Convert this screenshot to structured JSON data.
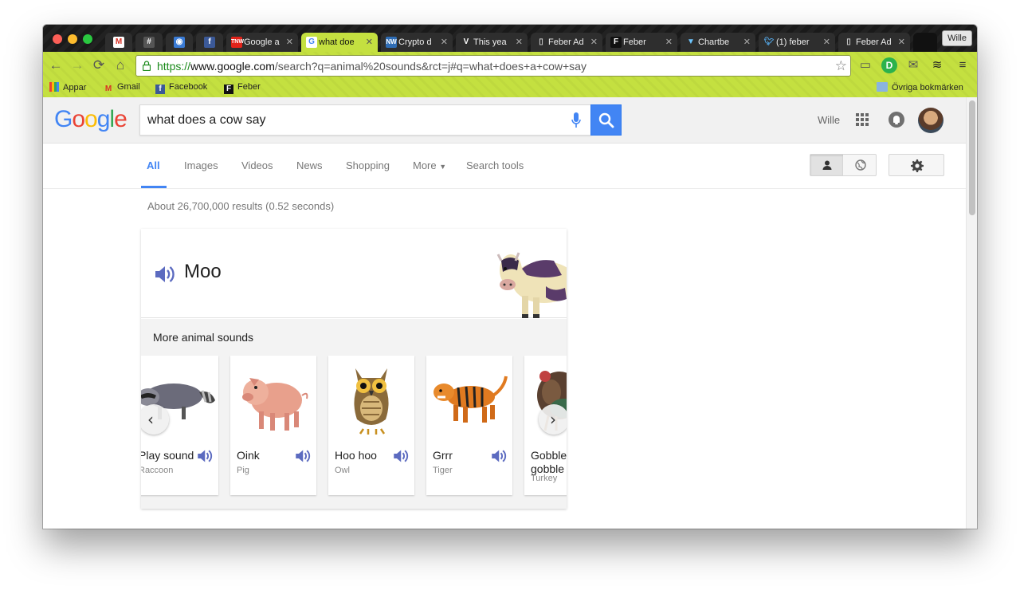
{
  "browser": {
    "profile_name": "Wille",
    "tabs": [
      {
        "label": "",
        "icon": "gmail-icon"
      },
      {
        "label": "",
        "icon": "hashtag-icon"
      },
      {
        "label": "",
        "icon": "rss-icon"
      },
      {
        "label": "",
        "icon": "facebook-icon"
      },
      {
        "label": "Google a",
        "icon": "tnw-icon"
      },
      {
        "label": "what doe",
        "icon": "google-icon"
      },
      {
        "label": "Crypto d",
        "icon": "nw-icon"
      },
      {
        "label": "This yea",
        "icon": "verge-icon"
      },
      {
        "label": "Feber Ad",
        "icon": "page-icon"
      },
      {
        "label": "Feber",
        "icon": "feber-icon"
      },
      {
        "label": "Chartbe",
        "icon": "chartbeat-icon"
      },
      {
        "label": "(1) feber",
        "icon": "twitter-icon"
      },
      {
        "label": "Feber Ad",
        "icon": "page-icon"
      }
    ],
    "url_scheme": "https://",
    "url_host": "www.google.com",
    "url_rest": "/search?q=animal%20sounds&rct=j#q=what+does+a+cow+say",
    "bookmarks": [
      {
        "label": "Appar",
        "icon": "apps-icon"
      },
      {
        "label": "Gmail",
        "icon": "gmail-icon"
      },
      {
        "label": "Facebook",
        "icon": "facebook-icon"
      },
      {
        "label": "Feber",
        "icon": "feber-icon"
      }
    ],
    "other_bookmarks": "Övriga bokmärken"
  },
  "google": {
    "logo": [
      "G",
      "o",
      "o",
      "g",
      "l",
      "e"
    ],
    "logo_colors": [
      "#4285f4",
      "#ea4335",
      "#fbbc05",
      "#4285f4",
      "#34a853",
      "#ea4335"
    ],
    "query": "what does a cow say",
    "user_name": "Wille",
    "nav_tabs": [
      "All",
      "Images",
      "Videos",
      "News",
      "Shopping",
      "More",
      "Search tools"
    ],
    "result_stats": "About 26,700,000 results (0.52 seconds)"
  },
  "answer": {
    "sound": "Moo",
    "more_label": "More animal sounds",
    "animals": [
      {
        "sound": "Play sound",
        "name": "Raccoon"
      },
      {
        "sound": "Oink",
        "name": "Pig"
      },
      {
        "sound": "Hoo hoo",
        "name": "Owl"
      },
      {
        "sound": "Grrr",
        "name": "Tiger"
      },
      {
        "sound": "Gobble gobble",
        "name": "Turkey"
      }
    ]
  },
  "colors": {
    "accent": "#4285f4",
    "speaker": "#5c6bc0",
    "toolbar": "#c4e040"
  }
}
